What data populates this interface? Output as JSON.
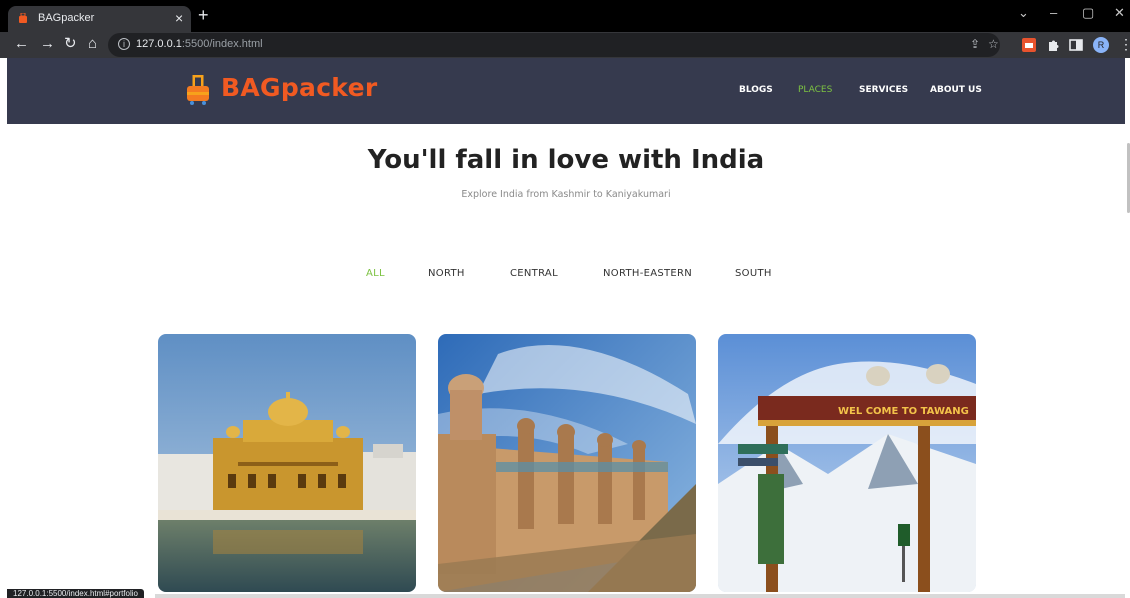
{
  "browser": {
    "tab_title": "BAGpacker",
    "tab_close": "×",
    "new_tab": "+",
    "url_host": "127.0.0.1",
    "url_rest": ":5500/index.html",
    "status_url": "127.0.0.1:5500/index.html#portfolio",
    "profile_initial": "R",
    "controls": {
      "minimize": "–",
      "restore": "▢",
      "close": "✕",
      "tab_search": "⌄"
    },
    "icons": [
      "back-arrow-icon",
      "forward-arrow-icon",
      "reload-icon",
      "home-icon",
      "info-icon",
      "share-icon",
      "star-icon",
      "puzzle-extension-icon",
      "side-panel-icon",
      "profile-avatar"
    ]
  },
  "site": {
    "brand": "BAGpacker",
    "brand_color": "#f15a22",
    "header_bg": "#363a4e",
    "accent": "#7cc242",
    "nav": [
      {
        "label": "BLOGS",
        "active": false
      },
      {
        "label": "PLACES",
        "active": true
      },
      {
        "label": "SERVICES",
        "active": false
      },
      {
        "label": "ABOUT US",
        "active": false
      }
    ]
  },
  "hero": {
    "title": "You'll fall in love with India",
    "subtitle": "Explore India from Kashmir to Kaniyakumari"
  },
  "filters": [
    {
      "label": "ALL",
      "active": true
    },
    {
      "label": "NORTH",
      "active": false
    },
    {
      "label": "CENTRAL",
      "active": false
    },
    {
      "label": "NORTH-EASTERN",
      "active": false
    },
    {
      "label": "SOUTH",
      "active": false
    }
  ],
  "gallery": [
    {
      "image": "golden-temple-photo"
    },
    {
      "image": "gwalior-fort-photo"
    },
    {
      "image": "tawang-gate-photo",
      "sign_text": "WEL COME TO TAWANG"
    }
  ]
}
